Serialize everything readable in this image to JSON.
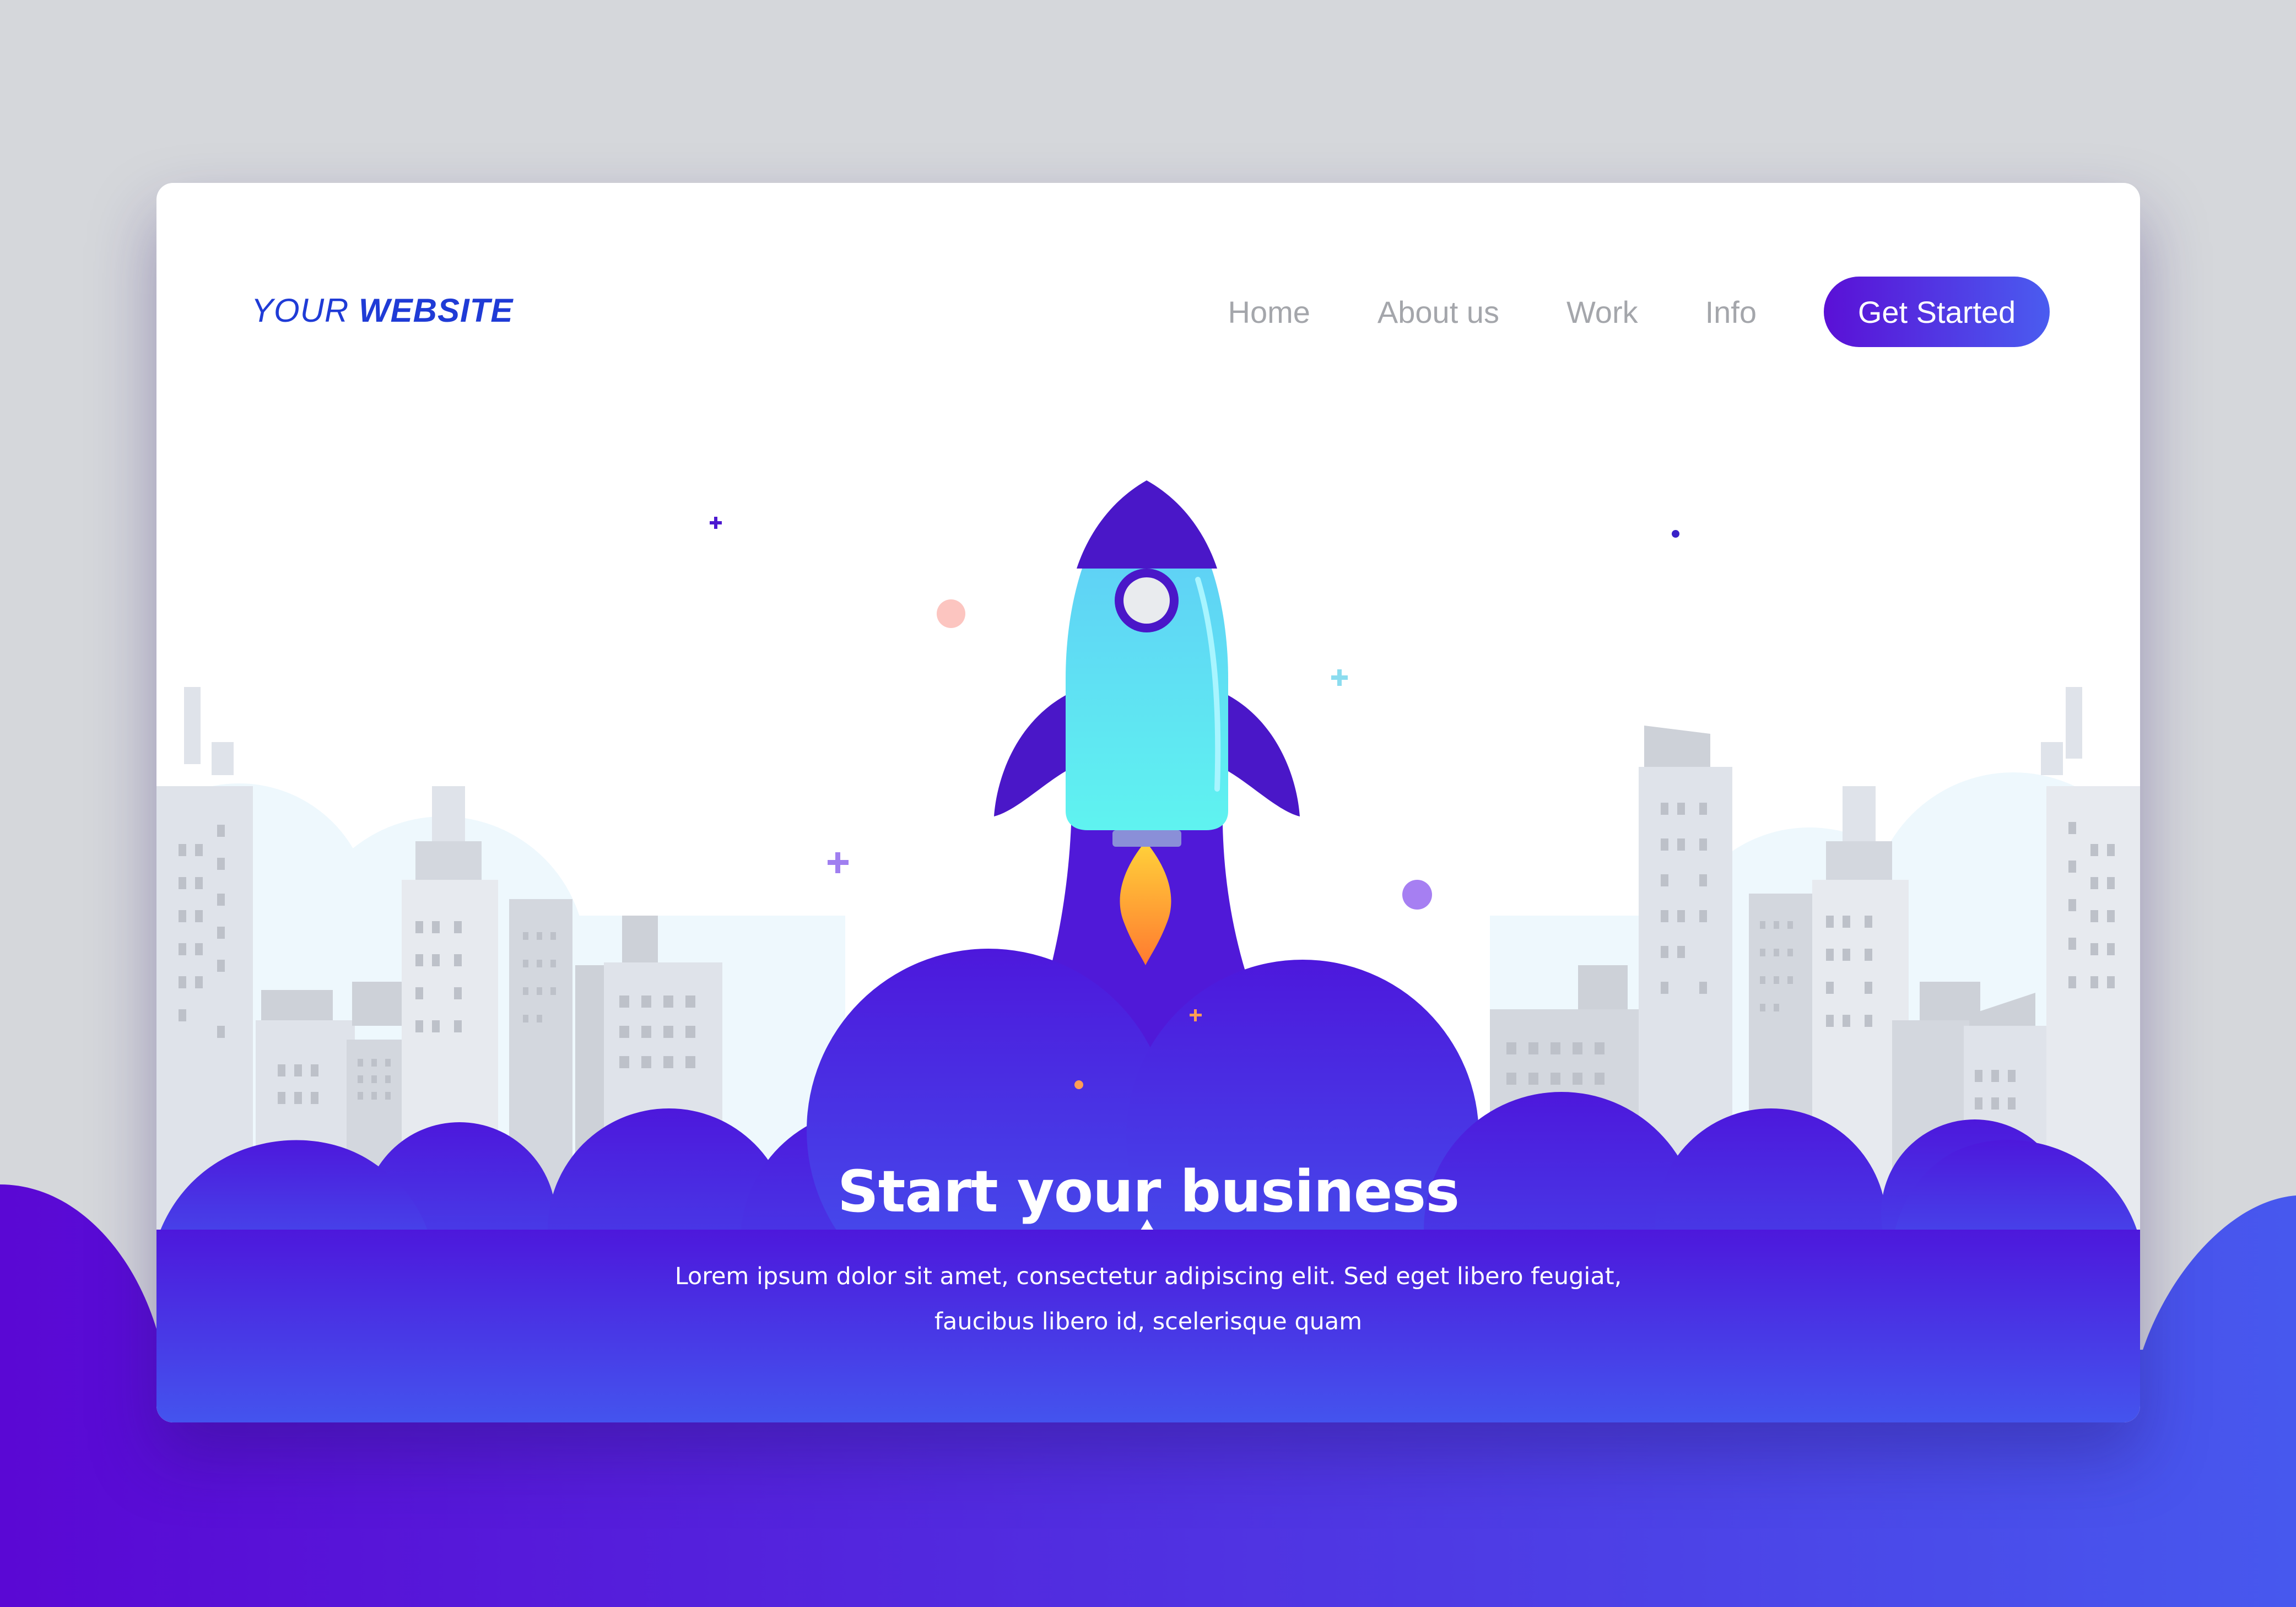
{
  "brand": {
    "logo_light": "YOUR",
    "logo_bold": "WEBSITE"
  },
  "nav": {
    "items": [
      "Home",
      "About us",
      "Work",
      "Info"
    ],
    "cta": "Get Started"
  },
  "hero": {
    "title": "Start your business",
    "subtitle_line1": "Lorem ipsum dolor sit amet, consectetur adipiscing elit. Sed eget libero feugiat,",
    "subtitle_line2": "faucibus libero id, scelerisque quam"
  },
  "colors": {
    "page_background": "#d5d7db",
    "brand_blue": "#1f3bd6",
    "purple_dark": "#5a0bd6",
    "purple_blue": "#4a55ee",
    "nav_text": "#a4a6ab",
    "rocket_body": "#5fd9f7",
    "flame": "#ff9d2e"
  },
  "icons": [
    "rocket-icon",
    "flame-icon",
    "sparkle-icon",
    "dot-icon",
    "building-icon",
    "cloud-icon"
  ]
}
